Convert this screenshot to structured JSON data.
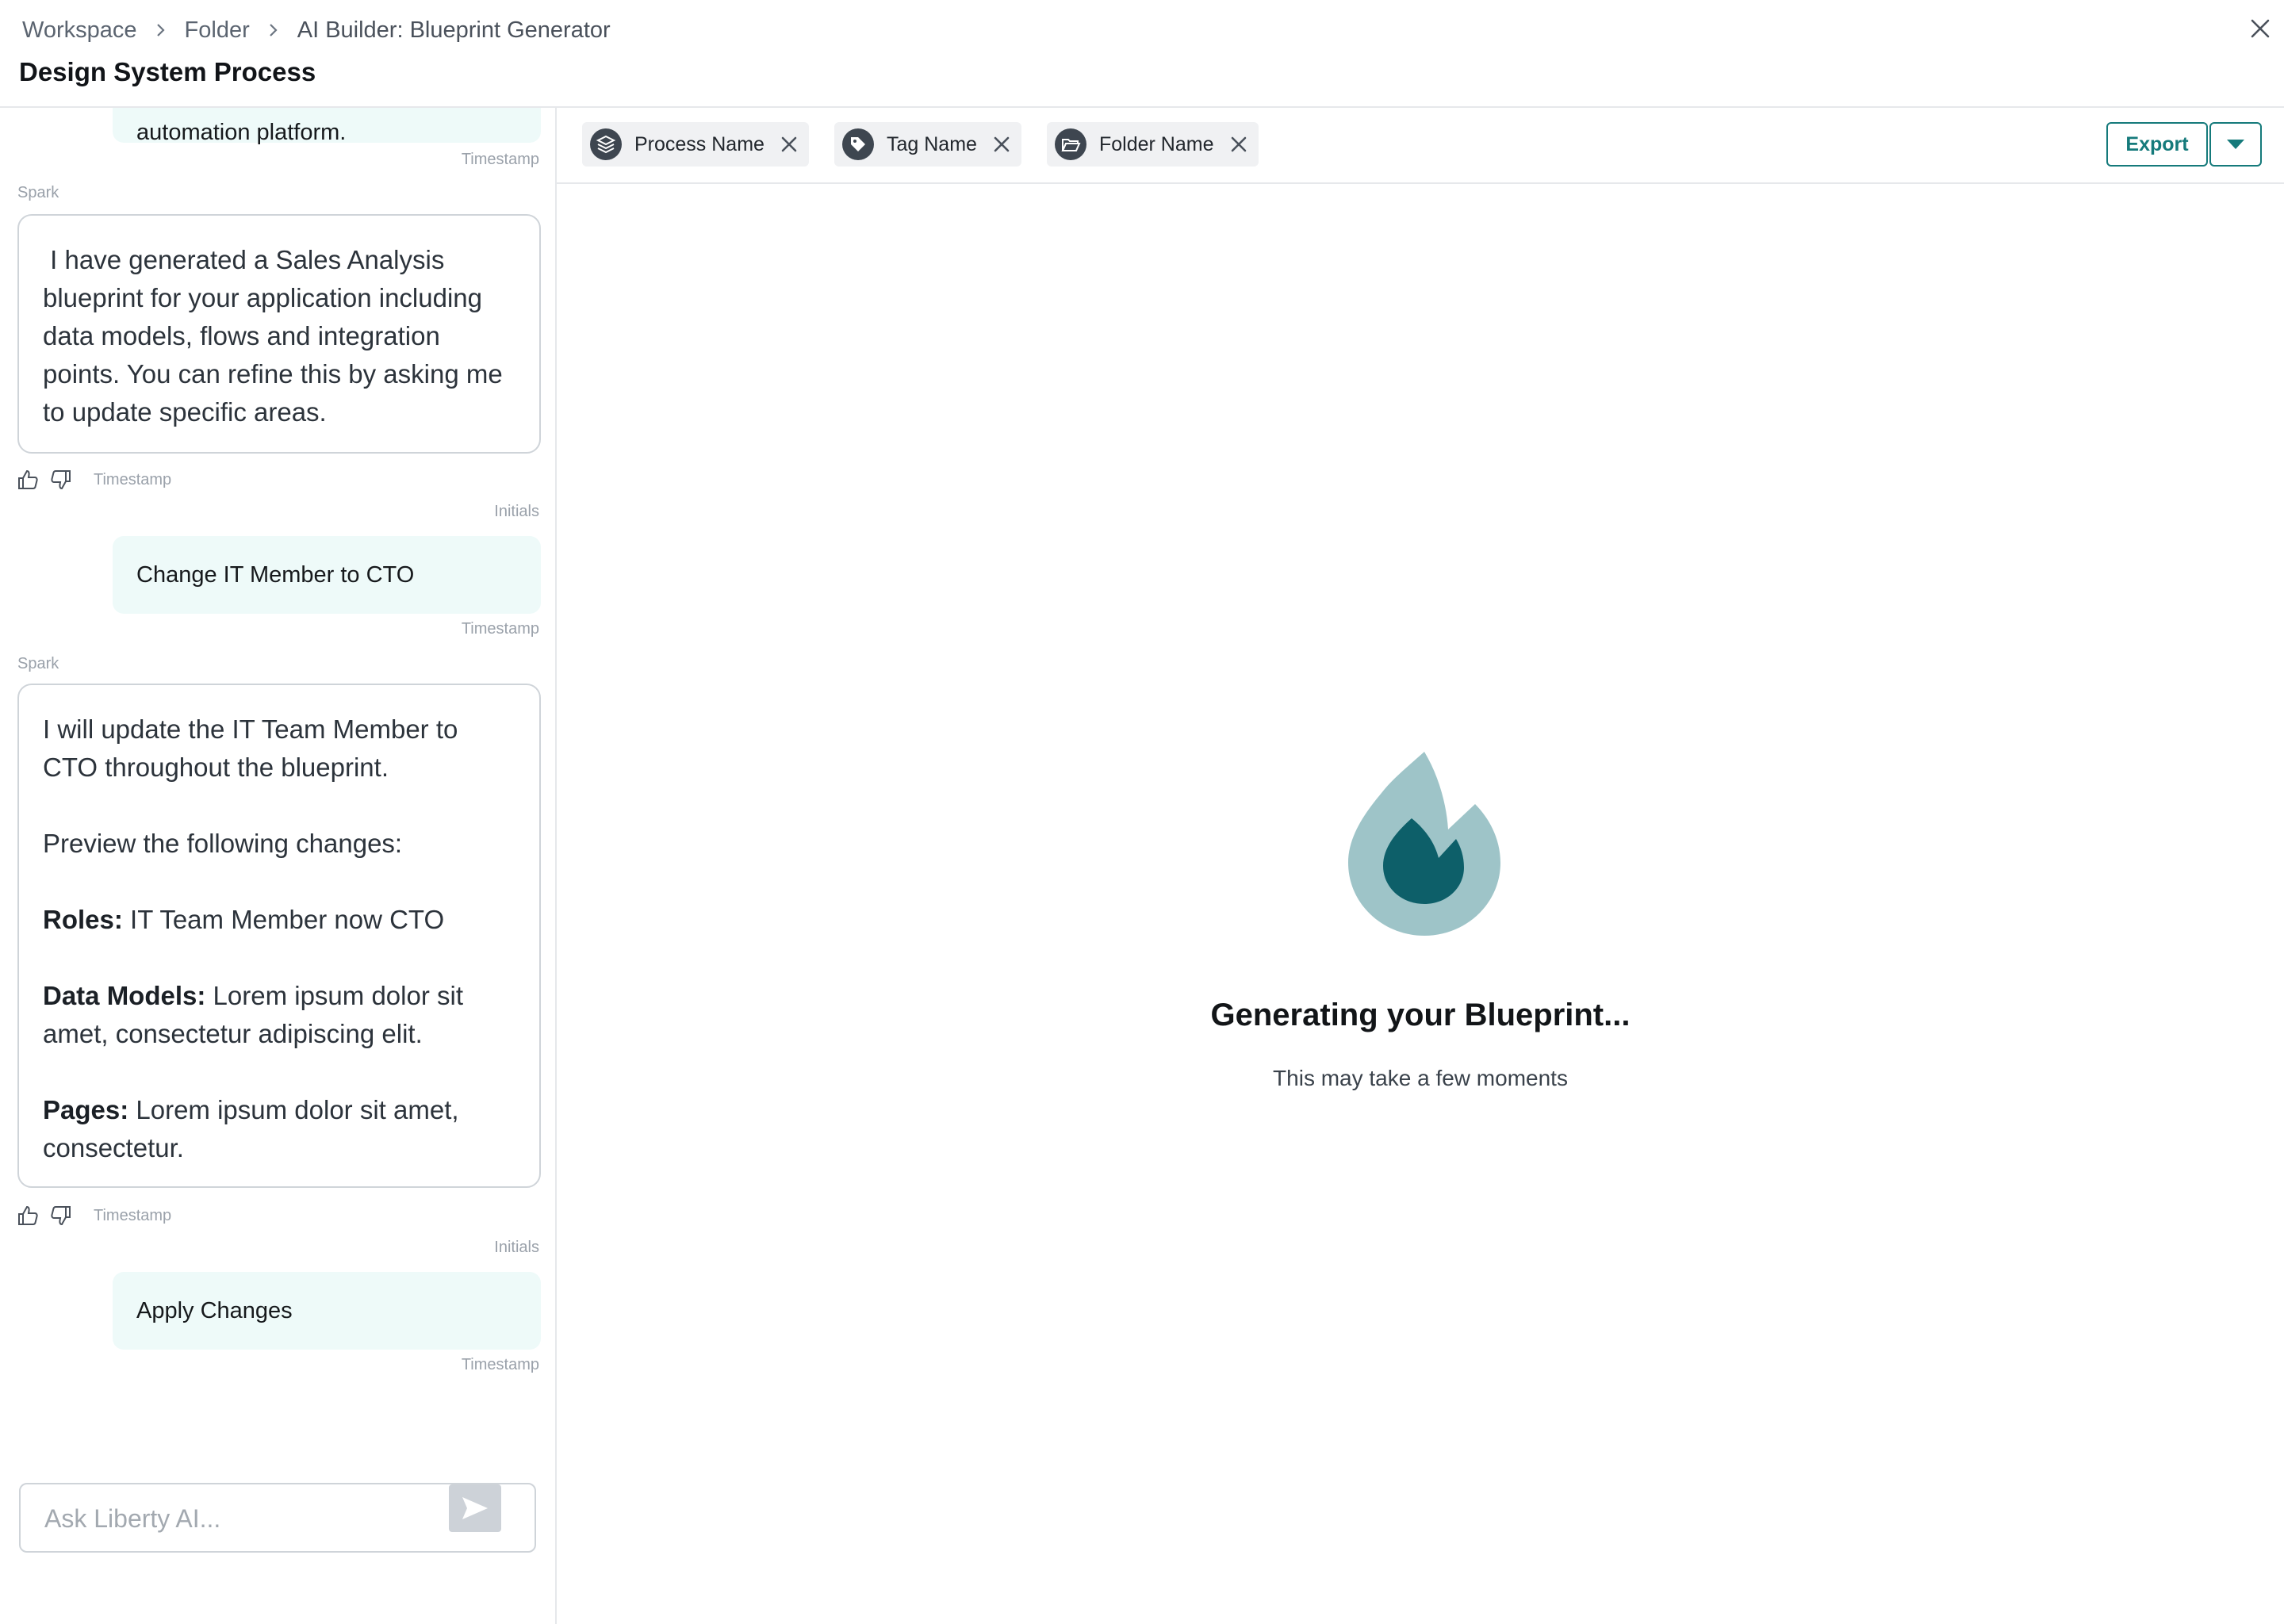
{
  "header": {
    "breadcrumb": [
      "Workspace",
      "Folder",
      "AI Builder: Blueprint Generator"
    ],
    "title": "Design System Process"
  },
  "chat": {
    "partial_top_text": "automation platform.",
    "messages": [
      {
        "timestamp": "Timestamp"
      },
      {
        "sender": "Spark",
        "text": " I have generated a Sales Analysis blueprint for your application including data models, flows and integration points. You can refine this by asking me to update specific areas.",
        "timestamp": "Timestamp"
      },
      {
        "initials": "Initials",
        "text": "Change IT Member to CTO",
        "timestamp": "Timestamp"
      },
      {
        "sender": "Spark",
        "intro": "I will update the IT Team Member to CTO throughout the blueprint.",
        "preview": "Preview the following changes:",
        "roles_label": "Roles:",
        "roles_text": " IT Team Member now CTO",
        "models_label": "Data Models:",
        "models_text": " Lorem ipsum dolor sit amet, consectetur adipiscing elit.",
        "pages_label": "Pages:",
        "pages_text": " Lorem ipsum dolor sit amet, consectetur.",
        "timestamp": "Timestamp"
      },
      {
        "initials": "Initials",
        "text": "Apply Changes",
        "timestamp": "Timestamp"
      }
    ],
    "input_placeholder": "Ask Liberty AI..."
  },
  "toolbar": {
    "chips": [
      {
        "label": "Process Name",
        "icon": "layers-icon"
      },
      {
        "label": "Tag Name",
        "icon": "tag-icon"
      },
      {
        "label": "Folder Name",
        "icon": "folder-open-icon"
      }
    ],
    "export_label": "Export"
  },
  "loading": {
    "title": "Generating your Blueprint...",
    "subtitle": "This may take a few moments"
  },
  "colors": {
    "accent": "#157a7b",
    "user_bubble": "#eefaf9",
    "flame_outer": "#9ec4c8",
    "flame_inner": "#0d5f69"
  }
}
